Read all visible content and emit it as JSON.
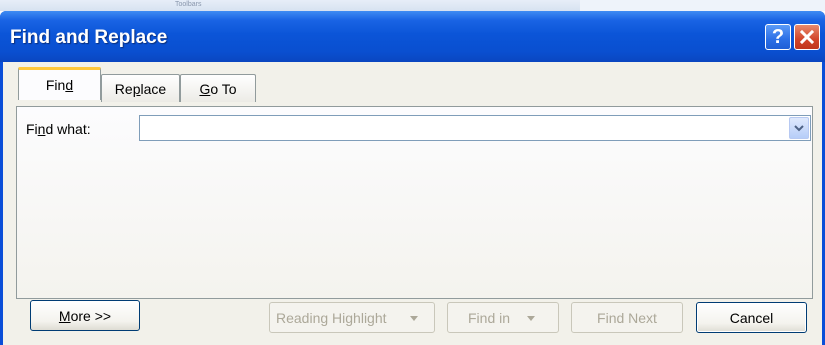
{
  "background": {
    "label": "Toolbars"
  },
  "window": {
    "title": "Find and Replace",
    "help_label": "?",
    "close_label": "×"
  },
  "tabs": [
    {
      "pre": "Fin",
      "key": "d",
      "post": "",
      "active": true
    },
    {
      "pre": "Re",
      "key": "p",
      "post": "lace",
      "active": false
    },
    {
      "pre": "",
      "key": "G",
      "post": "o To",
      "active": false
    }
  ],
  "find": {
    "label_pre": "Fi",
    "label_key": "n",
    "label_post": "d what:",
    "value": "",
    "placeholder": ""
  },
  "buttons": {
    "more": {
      "key": "M",
      "rest": "ore >>"
    },
    "reading_highlight": "Reading Highlight",
    "find_in": "Find in",
    "find_next": "Find Next",
    "cancel": "Cancel"
  },
  "colors": {
    "titlebar": "#0a4fd0",
    "active_tab_accent": "#ffc83c",
    "close_button": "#d2452a"
  },
  "icons": {
    "help": "help-icon",
    "close": "close-icon",
    "dropdown": "chevron-down-icon"
  }
}
